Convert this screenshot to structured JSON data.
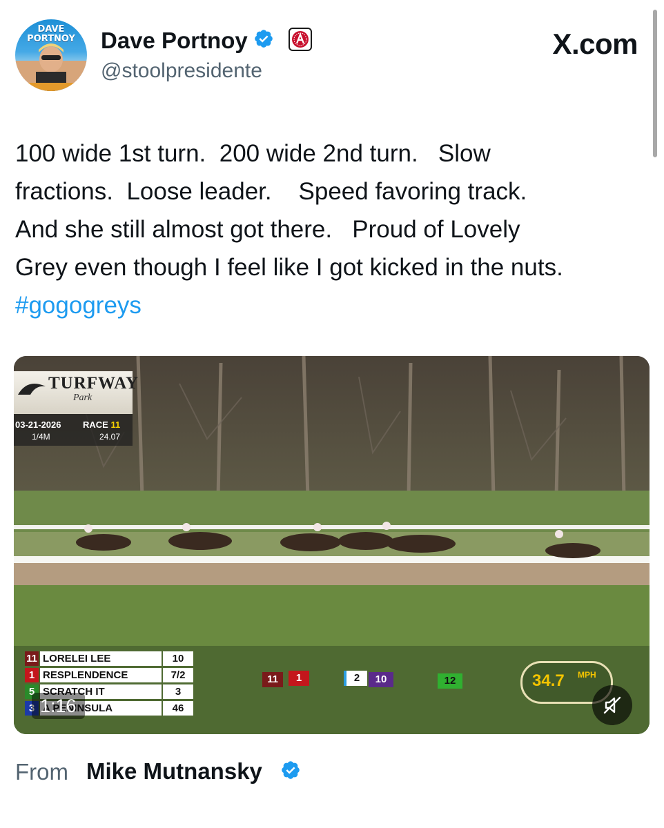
{
  "header": {
    "avatar_text_line1": "DAVE",
    "avatar_text_line2": "PORTNOY",
    "display_name": "Dave Portnoy",
    "handle": "@stoolpresidente",
    "site_label": "X.com",
    "verified_icon": "verified-badge-icon",
    "affiliate_icon": "barstool-badge-icon"
  },
  "tweet": {
    "lines": [
      "100 wide 1st turn.  200 wide 2nd turn.   Slow",
      "fractions.  Loose leader.    Speed favoring track.",
      "And she still almost got there.   Proud of Lovely",
      "Grey even though I feel like I got kicked in the nuts."
    ],
    "hashtag": "#gogogreys"
  },
  "video": {
    "track_name": "TURFWAY",
    "track_sub": "Park",
    "date": "03-21-2026",
    "race_label": "RACE",
    "race_number": "11",
    "distance": "1/4M",
    "fraction_time": "24.07",
    "leaderboard": [
      {
        "num": "11",
        "num_color": "#7a1a1a",
        "name": "LORELEI LEE",
        "odds": "10"
      },
      {
        "num": "1",
        "num_color": "#c4161c",
        "name": "RESPLENDENCE",
        "odds": "7/2"
      },
      {
        "num": "5",
        "num_color": "#2a8a2a",
        "name": "SCRATCH IT",
        "odds": "3"
      },
      {
        "num": "3",
        "num_color": "#1c3aa8",
        "name": "A PENINSULA",
        "odds": "46"
      }
    ],
    "position_chips": [
      "11",
      "1",
      "2",
      "10",
      "12"
    ],
    "speed": "34.7",
    "speed_unit": "MPH",
    "duration": "1:16",
    "mute_icon": "muted-speaker-icon"
  },
  "footer": {
    "from_label": "From",
    "from_name": "Mike Mutnansky",
    "verified_icon": "verified-badge-icon"
  },
  "colors": {
    "text": "#0f1419",
    "secondary": "#536471",
    "accent": "#1d9bf0"
  }
}
